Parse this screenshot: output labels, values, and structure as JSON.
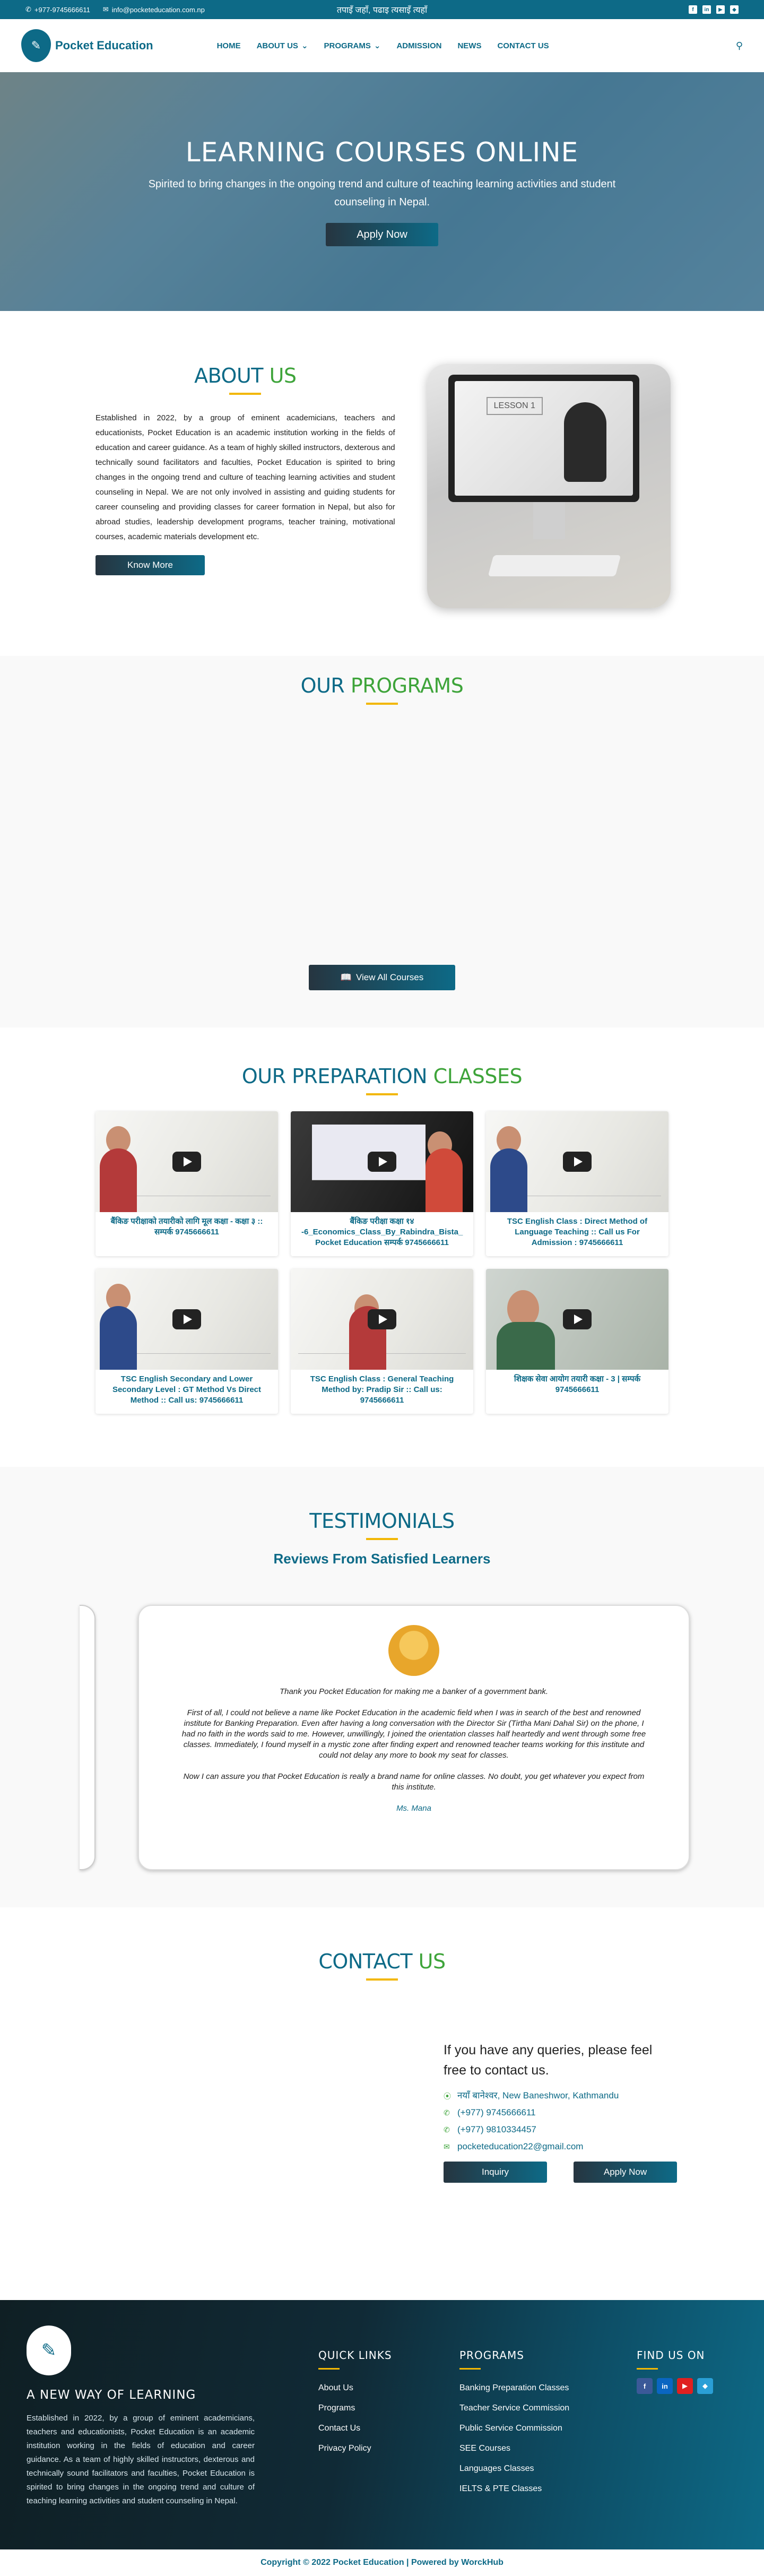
{
  "topbar": {
    "phone": "+977-9745666611",
    "email": "info@pocketeducation.com.np",
    "slogan": "तपाइँ जहाँ, पढाइ त्यसाइँ त्यहाँ",
    "socials": [
      "f",
      "in",
      "▶",
      "◆"
    ]
  },
  "header": {
    "logo_text": "Pocket Education",
    "nav": [
      "HOME",
      "ABOUT US",
      "PROGRAMS",
      "ADMISSION",
      "NEWS",
      "CONTACT US"
    ]
  },
  "hero": {
    "title": "LEARNING COURSES ONLINE",
    "subtitle": "Spirited to bring changes in the ongoing trend and culture of teaching learning activities and student counseling in Nepal.",
    "cta": "Apply Now"
  },
  "about": {
    "title_a": "ABOUT",
    "title_b": " US",
    "text": "Established in 2022, by a group of eminent academicians, teachers and educationists, Pocket Education is an academic institution working in the fields of education and career guidance. As a team of highly skilled instructors, dexterous and technically sound facilitators and faculties, Pocket Education is spirited to bring changes in the ongoing trend and culture of teaching learning activities and student counseling in Nepal. We are not only involved in assisting and guiding students for career counseling and providing classes for career formation in Nepal, but also for abroad studies, leadership development programs, teacher training, motivational courses, academic materials development etc.",
    "button": "Know More",
    "image_label": "LESSON 1"
  },
  "programs": {
    "title_a": "OUR",
    "title_b": " PROGRAMS",
    "button": "View All Courses"
  },
  "prep": {
    "title_a": "OUR PREPARATION",
    "title_b": " CLASSES",
    "cards": [
      {
        "title": "बैंकिङ परीक्षाको तयारीको लागि मूल कक्षा - कक्षा ३ :: सम्पर्क 9745666611"
      },
      {
        "title": "बैंकिङ परीक्षा कक्षा १४ -6_Economics_Class_By_Rabindra_Bista_ Pocket Education सम्पर्क 9745666611"
      },
      {
        "title": "TSC English Class : Direct Method of Language Teaching :: Call us For Admission : 9745666611"
      },
      {
        "title": "TSC English Secondary and Lower Secondary Level : GT Method Vs Direct Method :: Call us: 9745666611"
      },
      {
        "title": "TSC English Class : General Teaching Method by: Pradip Sir :: Call us: 9745666611"
      },
      {
        "title": "शिक्षक सेवा आयोग तयारी कक्षा - 3 | सम्पर्क 9745666611"
      }
    ]
  },
  "testimonials": {
    "title": "TESTIMONIALS",
    "subtitle": "Reviews From Satisfied Learners",
    "p1": "Thank you Pocket Education for making me a banker of a government bank.",
    "p2": "First of all, I could not believe a name like Pocket Education in the academic field when I was in search of the best and renowned institute for Banking Preparation.  Even after having a long conversation with the Director Sir (Tirtha Mani Dahal Sir) on the phone, I had no faith in the words said to me.  However, unwillingly, I joined the orientation classes half heartedly and went through some free classes. Immediately, I found myself in a mystic zone after finding expert and renowned teacher teams working for this institute and could not delay any more to book my seat for classes.",
    "p3": "Now I can assure you that Pocket Education is really a brand name for online classes. No doubt, you get whatever you expect from this institute.",
    "author": "Ms. Mana"
  },
  "contact": {
    "title_a": "CONTACT",
    "title_b": " US",
    "heading": "If you have any queries, please feel free to contact us.",
    "address": "नयाँ बानेश्वर, New Baneshwor, Kathmandu",
    "phone1": "(+977) 9745666611",
    "phone2": "(+977) 9810334457",
    "email": "pocketeducation22@gmail.com",
    "btn_inquiry": "Inquiry",
    "btn_apply": "Apply Now"
  },
  "footer": {
    "tagline": "A NEW WAY OF LEARNING",
    "text": "Established in 2022, by a group of eminent academicians, teachers and educationists, Pocket Education is an academic institution working in the fields of education and career guidance. As a team of highly skilled instructors, dexterous and technically sound facilitators and faculties, Pocket Education is spirited to bring changes in the ongoing trend and culture of teaching learning activities and student counseling in Nepal.",
    "quick_title": "QUICK LINKS",
    "quick_links": [
      "About Us",
      "Programs",
      "Contact Us",
      "Privacy Policy"
    ],
    "programs_title": "PROGRAMS",
    "programs": [
      "Banking Preparation Classes",
      "Teacher Service Commission",
      "Public Service Commission",
      "SEE Courses",
      "Languages Classes",
      "IELTS & PTE Classes"
    ],
    "find_title": "FIND US ON",
    "copyright": "Copyright © 2022 Pocket Education | Powered by WorckHub"
  },
  "colors": {
    "primary": "#0d6a87",
    "accent": "#3ea43a",
    "underline": "#f2b705"
  }
}
